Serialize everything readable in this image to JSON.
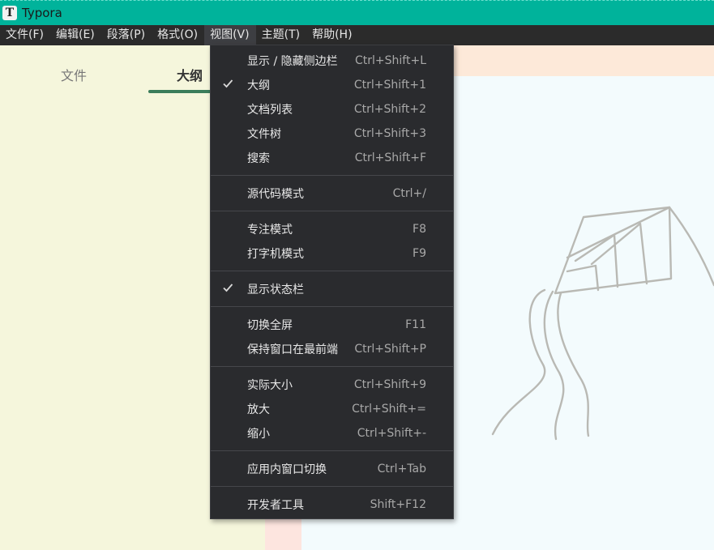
{
  "window": {
    "title": "Typora",
    "app_icon_letter": "T"
  },
  "menubar": [
    {
      "label": "文件(F)",
      "active": false
    },
    {
      "label": "编辑(E)",
      "active": false
    },
    {
      "label": "段落(P)",
      "active": false
    },
    {
      "label": "格式(O)",
      "active": false
    },
    {
      "label": "视图(V)",
      "active": true
    },
    {
      "label": "主题(T)",
      "active": false
    },
    {
      "label": "帮助(H)",
      "active": false
    }
  ],
  "sidebar": {
    "tabs": [
      {
        "label": "文件",
        "active": false
      },
      {
        "label": "大纲",
        "active": true
      }
    ]
  },
  "view_menu": {
    "groups": [
      [
        {
          "label": "显示 / 隐藏侧边栏",
          "shortcut": "Ctrl+Shift+L",
          "checked": false
        },
        {
          "label": "大纲",
          "shortcut": "Ctrl+Shift+1",
          "checked": true
        },
        {
          "label": "文档列表",
          "shortcut": "Ctrl+Shift+2",
          "checked": false
        },
        {
          "label": "文件树",
          "shortcut": "Ctrl+Shift+3",
          "checked": false
        },
        {
          "label": "搜索",
          "shortcut": "Ctrl+Shift+F",
          "checked": false
        }
      ],
      [
        {
          "label": "源代码模式",
          "shortcut": "Ctrl+/",
          "checked": false
        }
      ],
      [
        {
          "label": "专注模式",
          "shortcut": "F8",
          "checked": false
        },
        {
          "label": "打字机模式",
          "shortcut": "F9",
          "checked": false
        }
      ],
      [
        {
          "label": "显示状态栏",
          "shortcut": "",
          "checked": true
        }
      ],
      [
        {
          "label": "切换全屏",
          "shortcut": "F11",
          "checked": false
        },
        {
          "label": "保持窗口在最前端",
          "shortcut": "Ctrl+Shift+P",
          "checked": false
        }
      ],
      [
        {
          "label": "实际大小",
          "shortcut": "Ctrl+Shift+9",
          "checked": false
        },
        {
          "label": "放大",
          "shortcut": "Ctrl+Shift+=",
          "checked": false
        },
        {
          "label": "缩小",
          "shortcut": "Ctrl+Shift+-",
          "checked": false
        }
      ],
      [
        {
          "label": "应用内窗口切换",
          "shortcut": "Ctrl+Tab",
          "checked": false
        }
      ],
      [
        {
          "label": "开发者工具",
          "shortcut": "Shift+F12",
          "checked": false
        }
      ]
    ]
  },
  "icons": {
    "app": "typora-app-icon",
    "check": "checkmark-icon",
    "illustration": "kite-illustration"
  },
  "colors": {
    "titlebar": "#00b39b",
    "menubar": "#2b2b2b",
    "dropdown": "#2a2b2e",
    "sidebar": "#f5f6dc",
    "tab_underline": "#3b7d5a",
    "editor": "#f3fbfd"
  }
}
